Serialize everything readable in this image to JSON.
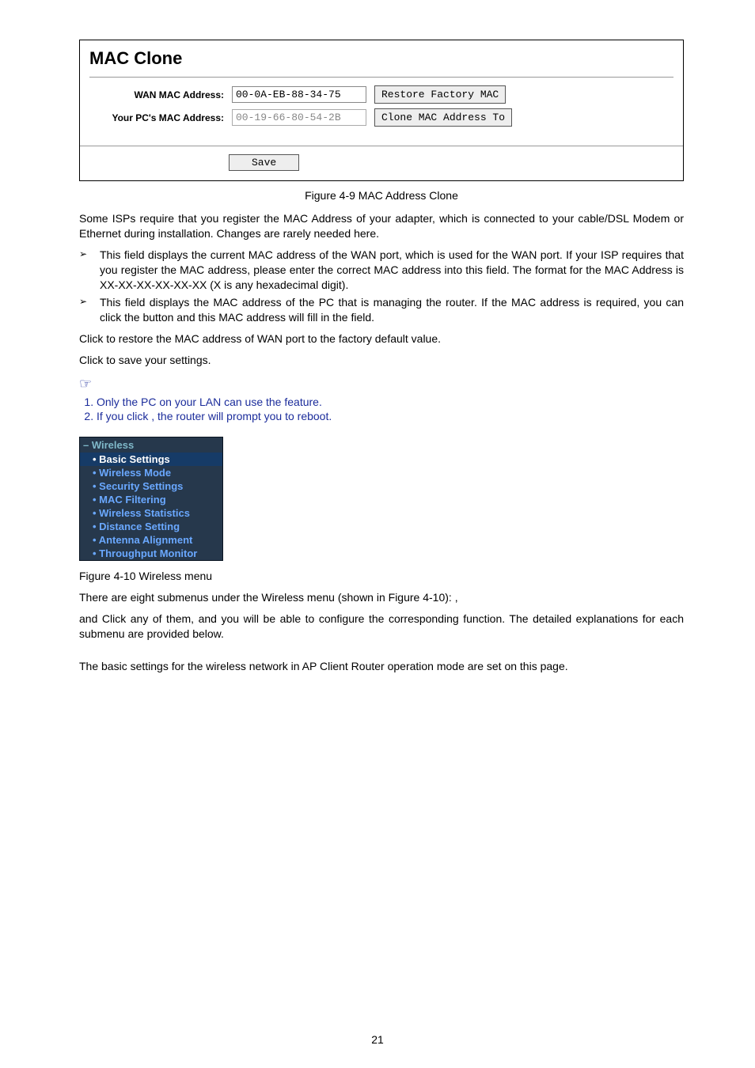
{
  "mac_panel": {
    "title": "MAC Clone",
    "wan_label": "WAN MAC Address:",
    "wan_value": "00-0A-EB-88-34-75",
    "restore_btn": "Restore Factory MAC",
    "pc_label": "Your PC's MAC Address:",
    "pc_value": "00-19-66-80-54-2B",
    "clone_btn": "Clone MAC Address To",
    "save_btn": "Save"
  },
  "fig49": "Figure 4-9   MAC Address Clone",
  "para1": "Some ISPs require that you register the MAC Address of your adapter, which is connected to your cable/DSL Modem or Ethernet during installation. Changes are rarely needed here.",
  "bullet1": "This field displays the current MAC address of the WAN port, which is used for the WAN port. If your ISP requires that you register the MAC address, please enter the correct MAC address into this field. The format for the MAC Address is XX-XX-XX-XX-XX-XX (X is any hexadecimal digit).",
  "bullet2a": "This field displays the MAC address of the PC that is managing the router. If the MAC address is required, you can click the ",
  "bullet2b": " button and this MAC address will fill in the ",
  "bullet2c": " field.",
  "para_click1a": "Click ",
  "para_click1b": " to restore the MAC address of WAN port to the factory default value.",
  "para_click2a": "Click ",
  "para_click2b": " to save your settings.",
  "note1": "Only the PC on your LAN can use the ",
  "note1b": " feature.",
  "note2a": "If you click ",
  "note2b": ", the router will prompt you to reboot.",
  "wireless": {
    "header": "Wireless",
    "items": [
      "Basic Settings",
      "Wireless Mode",
      "Security Settings",
      "MAC Filtering",
      "Wireless Statistics",
      "Distance Setting",
      "Antenna Alignment",
      "Throughput Monitor"
    ]
  },
  "fig410": "Figure 4-10 Wireless menu",
  "para_menu1": "There are eight submenus under the Wireless menu (shown in Figure 4-10): ",
  "para_menu1_end": ",",
  "para_menu2a": " and ",
  "para_menu2b": " Click any of them, and you will be able to configure the corresponding function. The detailed explanations for each submenu are provided below.",
  "para_basic": "The basic settings for the wireless network in AP Client Router operation mode are set on this page.",
  "page_num": "21"
}
